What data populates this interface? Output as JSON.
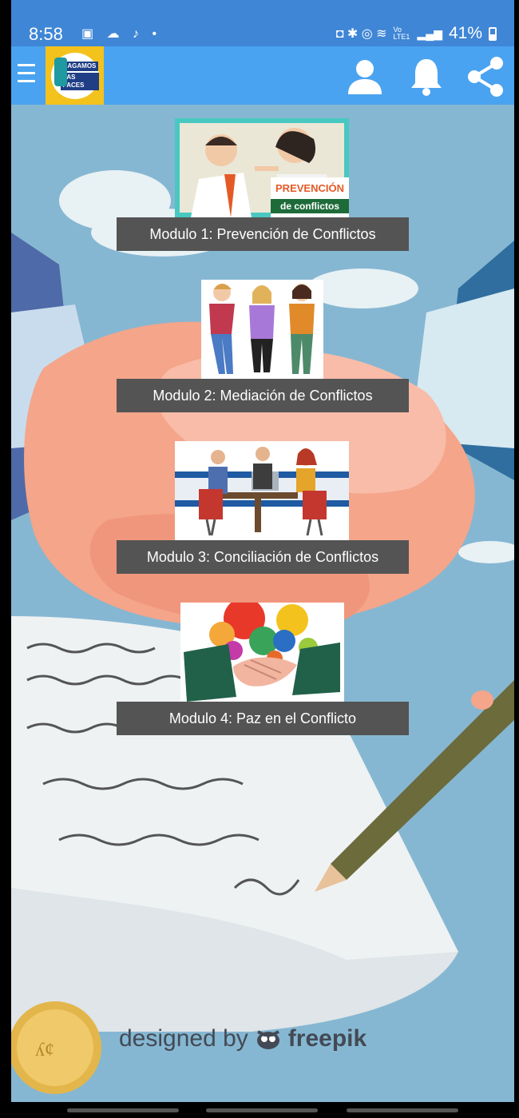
{
  "status_bar": {
    "time": "8:58",
    "left_icons": "▣ ☁ ♪ •",
    "battery": "41%",
    "network": "Vo LTE1"
  },
  "app_bar": {
    "logo_text_1": "HAGAMOS",
    "logo_text_2": "LAS PACES",
    "icons": [
      "menu-icon",
      "profile-icon",
      "bell-icon",
      "share-icon"
    ]
  },
  "modules": [
    {
      "caption": "Modulo 1: Prevención de Conflictos",
      "thumb_text_1": "PREVENCIÓN",
      "thumb_text_2": "de conflictos"
    },
    {
      "caption": "Modulo 2: Mediación de Conflictos"
    },
    {
      "caption": "Modulo 3: Conciliación de Conflictos"
    },
    {
      "caption": "Modulo 4: Paz en el Conflicto"
    }
  ],
  "credit": {
    "prefix": "designed by",
    "brand": "freepik"
  },
  "colors": {
    "status_bar": "#3f86d6",
    "app_bar": "#4aa3f0",
    "logo_bg": "#f4c21c",
    "caption_bg": "#545454",
    "background": "#7fb0cc"
  }
}
